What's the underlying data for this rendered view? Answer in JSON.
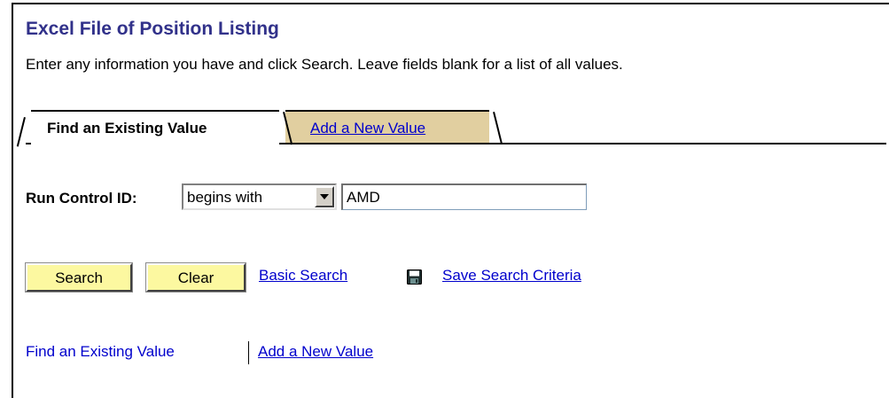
{
  "page": {
    "title": "Excel File of Position Listing",
    "instructions": "Enter any information you have and click Search. Leave fields blank for a list of all values."
  },
  "tabs": [
    {
      "label": "Find an Existing Value",
      "active": true
    },
    {
      "label": "Add a New Value",
      "active": false
    }
  ],
  "search_form": {
    "run_control_label": "Run Control ID:",
    "operator_selected": "begins with",
    "run_control_value": "AMD"
  },
  "actions": {
    "search_label": "Search",
    "clear_label": "Clear",
    "basic_search_label": "Basic Search",
    "save_criteria_label": "Save Search Criteria",
    "save_icon": "floppy-disk-icon"
  },
  "bottom_links": {
    "find_existing": "Find an Existing Value",
    "add_new": "Add a New Value"
  },
  "colors": {
    "title": "#31318a",
    "link": "#0000cc",
    "inactive_tab": "#e1cfa0",
    "button": "#fcf8a0"
  }
}
